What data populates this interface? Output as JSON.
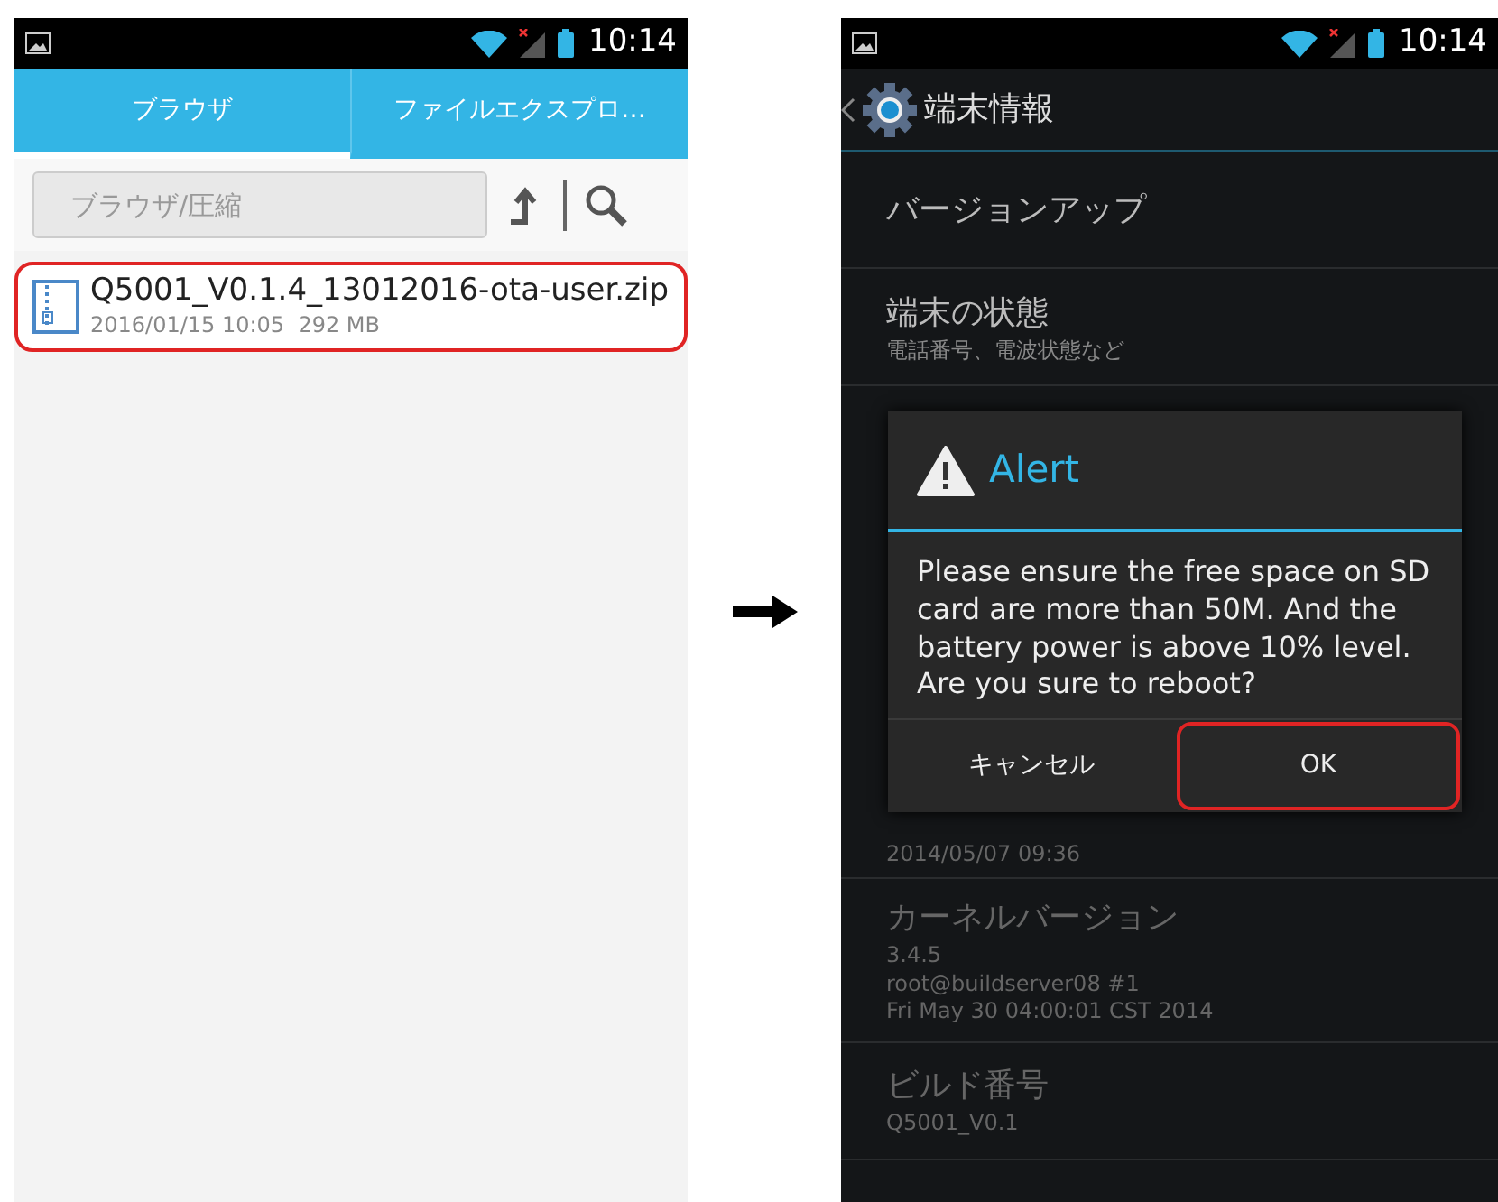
{
  "left_screen": {
    "status_bar": {
      "time": "10:14"
    },
    "tabs": [
      {
        "label": "ブラウザ",
        "selected": true
      },
      {
        "label": "ファイルエクスプロ…",
        "selected": false
      }
    ],
    "toolbar": {
      "path_field": {
        "placeholder": "ブラウザ/圧縮"
      }
    },
    "files": [
      {
        "name": "Q5001_V0.1.4_13012016-ota-user.zip",
        "details": "2016/01/15 10:05  292 MB",
        "highlighted": true
      }
    ]
  },
  "right_screen": {
    "status_bar": {
      "time": "10:14"
    },
    "action_bar": {
      "title": "端末情報"
    },
    "settings_items": [
      {
        "kind": "item",
        "title": "バージョンアップ"
      },
      {
        "kind": "item",
        "title": "端末の状態",
        "subtitle": "電話番号、電波状態など"
      },
      {
        "kind": "covered",
        "subtitle": "2014/05/07 09:36"
      },
      {
        "kind": "item",
        "title": "カーネルバージョン",
        "subtitle": "3.4.5\nroot@buildserver08 #1\nFri May 30 04:00:01 CST 2014"
      },
      {
        "kind": "item",
        "title": "ビルド番号",
        "subtitle": "Q5001_V0.1"
      }
    ],
    "dialog": {
      "title": "Alert",
      "message": "Please ensure the free space on SD card are more than 50M. And the battery power is above 10% level.\nAre you sure to reboot?",
      "buttons": [
        {
          "label": "キャンセル",
          "highlighted": false
        },
        {
          "label": "OK",
          "highlighted": true
        }
      ]
    }
  }
}
